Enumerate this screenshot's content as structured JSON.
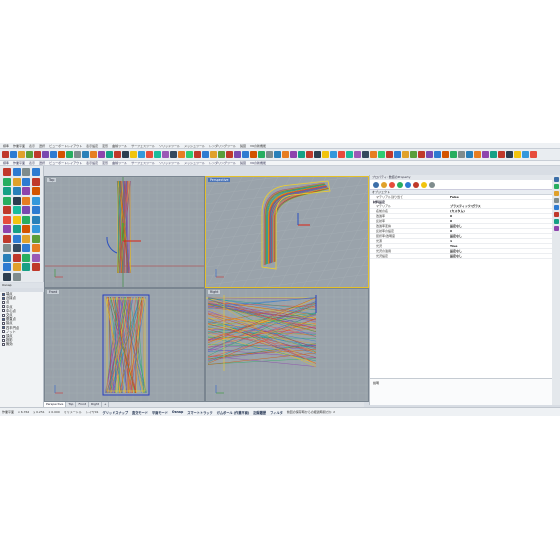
{
  "menu": [
    "標準",
    "作業平面",
    "表示",
    "選択",
    "ビューポートレイアウト",
    "表示設定",
    "変形",
    "曲線ツール",
    "サーフェスツール",
    "ソリッドツール",
    "メッシュツール",
    "レンダリングツール",
    "製図",
    "V6の新機能"
  ],
  "tabs": [
    "標準",
    "作業平面",
    "表示",
    "選択",
    "ビューポートレイアウト",
    "表示設定",
    "変形",
    "曲線ツール",
    "サーフェスツール",
    "ソリッドツール",
    "メッシュツール",
    "レンダリングツール",
    "製図",
    "V6の新機能"
  ],
  "toolbar_colors": [
    "#c0392b",
    "#2e7bd1",
    "#e0a12b",
    "#5a9e3a",
    "#c0392b",
    "#7a4ab0",
    "#2e7bd1",
    "#d35400",
    "#27ae60",
    "#7f8c8d",
    "#2980b9",
    "#e67e22",
    "#8e44ad",
    "#16a085",
    "#c0392b",
    "#2c3e50",
    "#f1c40f",
    "#3498db",
    "#e74c3c",
    "#1abc9c",
    "#9b59b6",
    "#34495e",
    "#e67e22",
    "#2ecc71",
    "#c0392b",
    "#2e7bd1",
    "#e0a12b",
    "#5a9e3a",
    "#c0392b",
    "#7a4ab0",
    "#2e7bd1",
    "#d35400",
    "#27ae60",
    "#7f8c8d",
    "#2980b9",
    "#e67e22",
    "#8e44ad",
    "#16a085",
    "#c0392b",
    "#2c3e50",
    "#f1c40f",
    "#3498db",
    "#e74c3c",
    "#1abc9c",
    "#9b59b6",
    "#34495e",
    "#e67e22",
    "#2ecc71",
    "#c0392b",
    "#2e7bd1",
    "#e0a12b",
    "#5a9e3a",
    "#c0392b",
    "#7a4ab0",
    "#2e7bd1",
    "#d35400",
    "#27ae60",
    "#7f8c8d",
    "#2980b9",
    "#e67e22",
    "#8e44ad",
    "#16a085",
    "#c0392b",
    "#2c3e50",
    "#f1c40f",
    "#3498db",
    "#e74c3c"
  ],
  "left_tool_colors": [
    "#c0392b",
    "#2e7bd1",
    "#7f8c8d",
    "#2e7bd1",
    "#27ae60",
    "#e0a12b",
    "#2e7bd1",
    "#c0392b",
    "#16a085",
    "#2980b9",
    "#8e44ad",
    "#d35400",
    "#27ae60",
    "#2c3e50",
    "#e67e22",
    "#3498db",
    "#c0392b",
    "#1abc9c",
    "#7a4ab0",
    "#2e7bd1",
    "#e74c3c",
    "#f1c40f",
    "#27ae60",
    "#2980b9",
    "#8e44ad",
    "#16a085",
    "#d35400",
    "#3498db",
    "#c0392b",
    "#2e7bd1",
    "#e0a12b",
    "#5a9e3a",
    "#7f8c8d",
    "#34495e",
    "#2e7bd1",
    "#e67e22",
    "#2980b9",
    "#c0392b",
    "#27ae60",
    "#9b59b6",
    "#2e7bd1",
    "#e0a12b",
    "#16a085",
    "#c0392b",
    "#2c3e50",
    "#7f8c8d"
  ],
  "snap_title": "Osnap",
  "osnaps": [
    {
      "label": "端点",
      "on": true
    },
    {
      "label": "近接点",
      "on": true
    },
    {
      "label": "点",
      "on": false
    },
    {
      "label": "中点",
      "on": false
    },
    {
      "label": "中心点",
      "on": false
    },
    {
      "label": "交点",
      "on": false
    },
    {
      "label": "垂直点",
      "on": true
    },
    {
      "label": "接点",
      "on": false
    },
    {
      "label": "四半円点",
      "on": true
    },
    {
      "label": "ノット",
      "on": false
    },
    {
      "label": "頂点",
      "on": false
    },
    {
      "label": "投影",
      "on": false
    },
    {
      "label": "無効",
      "on": false
    }
  ],
  "viewports": [
    {
      "id": "top",
      "label": "Top",
      "active": false
    },
    {
      "id": "perspective",
      "label": "Perspective",
      "active": true
    },
    {
      "id": "front",
      "label": "Front",
      "active": false
    },
    {
      "id": "right",
      "label": "Right",
      "active": false
    }
  ],
  "viewport_tabs": [
    "Perspective",
    "Top",
    "Front",
    "Right",
    "+"
  ],
  "properties": {
    "header": "プロパティ: 数値のProperty",
    "icon_colors": [
      "#3b6ea8",
      "#e0a12b",
      "#e74c3c",
      "#27ae60",
      "#2e7bd1",
      "#c0392b",
      "#f1c40f",
      "#7f8c8d"
    ],
    "section": "オブジェクト",
    "rows": [
      {
        "k": "マテリアル割り当て",
        "v": "False",
        "sub": false
      },
      {
        "k": "材料設定",
        "v": "",
        "sub": true
      },
      {
        "k": "マテリアル",
        "v": "プラスティック/ガラス",
        "sub": false
      },
      {
        "k": "名前の名",
        "v": "(カスタム)",
        "sub": false
      },
      {
        "k": "透過率",
        "v": "0",
        "sub": false
      },
      {
        "k": "反射率",
        "v": "0",
        "sub": false
      },
      {
        "k": "透過率変換",
        "v": "設定なし",
        "sub": false
      },
      {
        "k": "反射率の設定",
        "v": "0",
        "sub": false
      },
      {
        "k": "屈折率/透明度",
        "v": "設定なし",
        "sub": false
      },
      {
        "k": "光源",
        "v": "1",
        "sub": false
      },
      {
        "k": "光沢",
        "v": "True",
        "sub": false
      },
      {
        "k": "光沢の適用",
        "v": "設定なし",
        "sub": false
      },
      {
        "k": "光沢設定",
        "v": "設定なし",
        "sub": false
      }
    ],
    "footer_label": "説明"
  },
  "status": {
    "plane_label": "作業平面",
    "x": "x 6.762",
    "y": "y 0.251",
    "z": "z 0.000",
    "units": "ミリメートル",
    "layer": "レイヤ01",
    "buttons": [
      "グリッドスナップ",
      "直交モード",
      "平面モード",
      "Osnap",
      "スマートトラック",
      "ガムボール (作業平面)",
      "記録履歴",
      "フィルタ"
    ],
    "hint": "前回の保存時からの経過時間(分): 2",
    "extra": "ヒストリを記録"
  }
}
